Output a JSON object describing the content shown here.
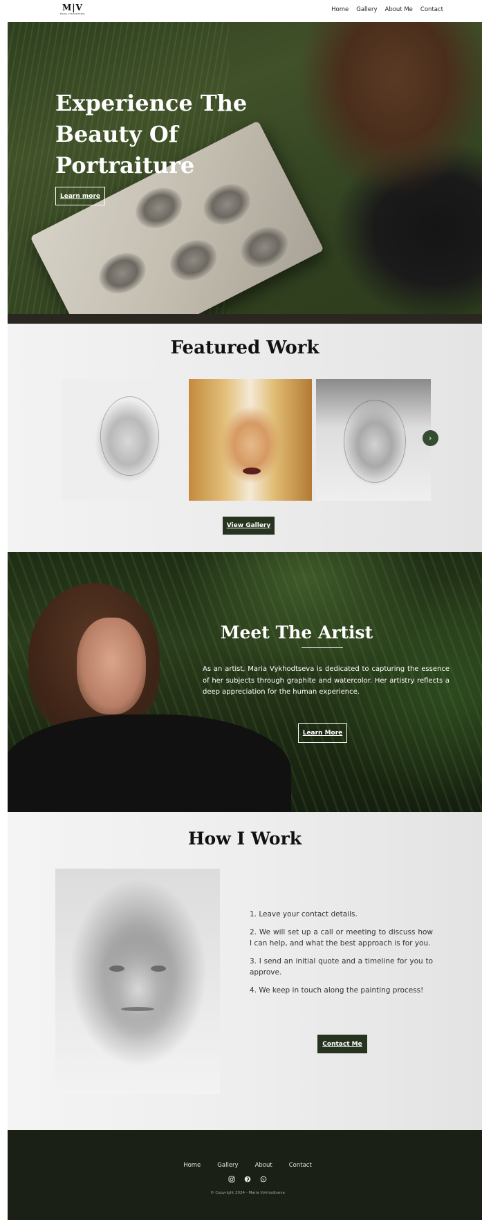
{
  "header": {
    "logo_mark": "M|V",
    "logo_sub": "MARIA VYKHODTSEVA",
    "nav": [
      "Home",
      "Gallery",
      "About Me",
      "Contact"
    ]
  },
  "hero": {
    "title": "Experience The Beauty Of Portraiture",
    "button_label": "Learn more"
  },
  "featured": {
    "title": "Featured Work",
    "next_icon": "chevron-right-icon",
    "next_glyph": "›",
    "button_label": "View Gallery"
  },
  "artist": {
    "title": "Meet The Artist",
    "text": "As an artist, Maria Vykhodtseva is dedicated to capturing the essence of her subjects through graphite and watercolor. Her artistry reflects a deep appreciation for the human experience.",
    "button_label": "Learn More"
  },
  "work": {
    "title": "How I Work",
    "steps": [
      "1. Leave your contact details.",
      "2. We will set up a call or meeting to discuss how I can help, and what the best approach is for you.",
      "3. I send an initial quote and a timeline for you to approve.",
      "4. We keep in touch along the painting process!"
    ],
    "button_label": "Contact Me"
  },
  "footer": {
    "nav": [
      "Home",
      "Gallery",
      "About",
      "Contact"
    ],
    "social_icons": [
      "instagram-icon",
      "pinterest-icon",
      "whatsapp-icon"
    ],
    "copyright": "© Copyright 2024 - Maria Vykhodtseva"
  },
  "colors": {
    "accent_dark_green": "#26331f",
    "footer_bg": "#1a2015",
    "carousel_button": "#344d30"
  }
}
